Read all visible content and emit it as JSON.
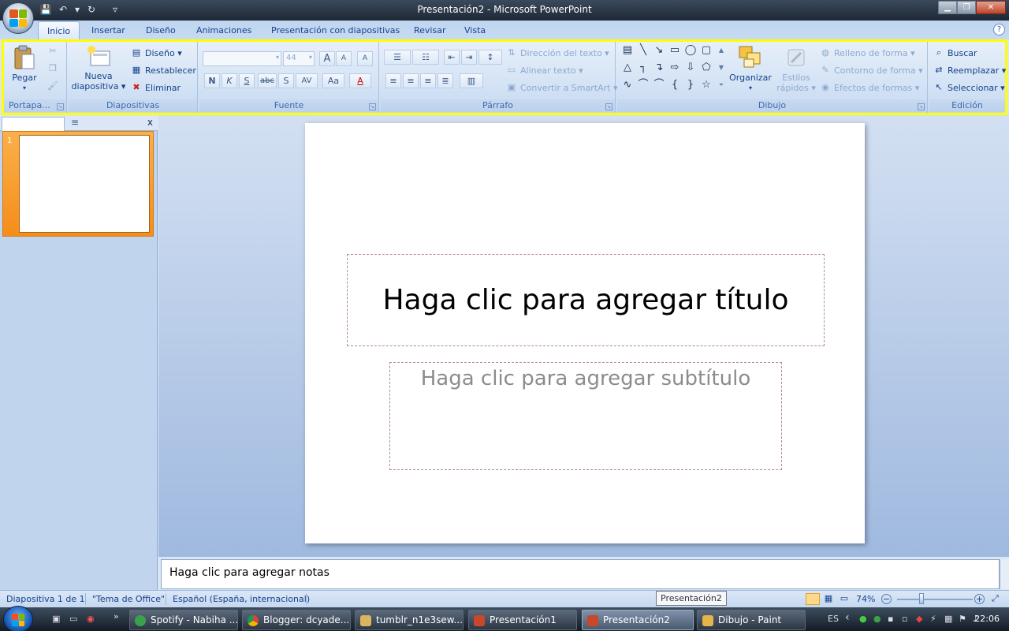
{
  "window": {
    "title": "Presentación2 - Microsoft PowerPoint",
    "buttons": {
      "minimize": "▁",
      "maximize": "❐",
      "close": "✕"
    }
  },
  "qat": {
    "save": "💾",
    "undo": "↶",
    "undo_dd": "▾",
    "redo": "↻",
    "customize": "▿"
  },
  "tabs": [
    "Inicio",
    "Insertar",
    "Diseño",
    "Animaciones",
    "Presentación con diapositivas",
    "Revisar",
    "Vista"
  ],
  "help": "?",
  "ribbon": {
    "portapapeles": {
      "label": "Portapa...",
      "paste": "Pegar",
      "paste_dd": "▾"
    },
    "diapositivas": {
      "label": "Diapositivas",
      "new_slide_1": "Nueva",
      "new_slide_2": "diapositiva ▾",
      "layout": "Diseño ▾",
      "reset": "Restablecer",
      "delete": "Eliminar"
    },
    "fuente": {
      "label": "Fuente",
      "font_name": "",
      "font_size": "44",
      "grow": "A",
      "shrink": "A",
      "clear": "A",
      "bold": "N",
      "italic": "K",
      "underline": "S",
      "strike": "abc",
      "shadow": "S",
      "spacing": "AV",
      "case": "Aa",
      "color": "A"
    },
    "parrafo": {
      "label": "Párrafo",
      "text_direction": "Dirección del texto ▾",
      "align_text": "Alinear texto ▾",
      "smartart": "Convertir a SmartArt ▾"
    },
    "dibujo": {
      "label": "Dibujo",
      "arrange": "Organizar",
      "arrange_dd": "▾",
      "quick_styles_1": "Estilos",
      "quick_styles_2": "rápidos ▾",
      "shape_fill": "Relleno de forma ▾",
      "shape_outline": "Contorno de forma ▾",
      "shape_effects": "Efectos de formas ▾"
    },
    "edicion": {
      "label": "Edición",
      "find": "Buscar",
      "replace": "Reemplazar ▾",
      "select": "Seleccionar ▾"
    }
  },
  "slides_pane": {
    "close": "x",
    "thumb_number": "1"
  },
  "slide": {
    "title_placeholder": "Haga clic para agregar título",
    "subtitle_placeholder": "Haga clic para agregar subtítulo"
  },
  "notes": {
    "placeholder": "Haga clic para agregar notas"
  },
  "status": {
    "slide_info": "Diapositiva 1 de 1",
    "theme": "\"Tema de Office\"",
    "language": "Español (España, internacional)",
    "zoom": "74%",
    "zoom_minus": "−",
    "zoom_plus": "+"
  },
  "tooltip": "Presentación2",
  "taskbar": {
    "overflow": "»",
    "tasks": [
      {
        "label": "Spotify - Nabiha ...",
        "color": "#3aa34a"
      },
      {
        "label": "Blogger: dcyade...",
        "color": "#e0a020"
      },
      {
        "label": "tumblr_n1e3sew...",
        "color": "#d9b560"
      },
      {
        "label": "Presentación1",
        "color": "#c9472a"
      },
      {
        "label": "Presentación2",
        "color": "#c9472a"
      },
      {
        "label": "Dibujo - Paint",
        "color": "#e6b54a"
      }
    ],
    "language": "ES",
    "tray_arrow": "‹",
    "clock": "22:06"
  }
}
